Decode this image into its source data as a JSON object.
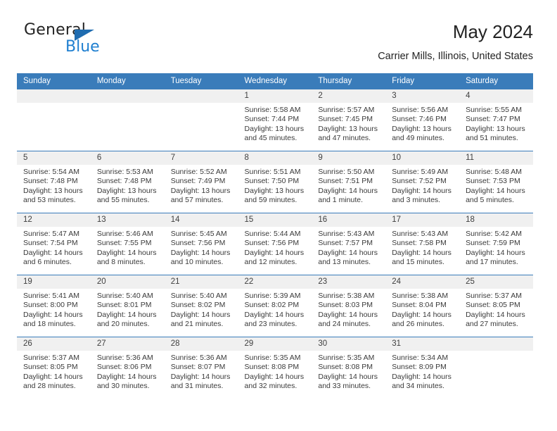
{
  "brand": {
    "name_top": "General",
    "name_bottom": "Blue",
    "accent_color": "#1f7fd0",
    "triangle_color": "#1f6cb0"
  },
  "header": {
    "title": "May 2024",
    "subtitle": "Carrier Mills, Illinois, United States"
  },
  "theme": {
    "header_bg": "#3a7cba",
    "daynum_bg": "#f0f0f0",
    "text": "#3a3a3a"
  },
  "labels": {
    "sunrise_prefix": "Sunrise:",
    "sunset_prefix": "Sunset:",
    "daylight_prefix": "Daylight:"
  },
  "columns": [
    "Sunday",
    "Monday",
    "Tuesday",
    "Wednesday",
    "Thursday",
    "Friday",
    "Saturday"
  ],
  "weeks": [
    [
      {
        "day": "",
        "sunrise": "",
        "sunset": "",
        "daylight_line1": "",
        "daylight_line2": ""
      },
      {
        "day": "",
        "sunrise": "",
        "sunset": "",
        "daylight_line1": "",
        "daylight_line2": ""
      },
      {
        "day": "",
        "sunrise": "",
        "sunset": "",
        "daylight_line1": "",
        "daylight_line2": ""
      },
      {
        "day": "1",
        "sunrise": "Sunrise: 5:58 AM",
        "sunset": "Sunset: 7:44 PM",
        "daylight_line1": "Daylight: 13 hours",
        "daylight_line2": "and 45 minutes."
      },
      {
        "day": "2",
        "sunrise": "Sunrise: 5:57 AM",
        "sunset": "Sunset: 7:45 PM",
        "daylight_line1": "Daylight: 13 hours",
        "daylight_line2": "and 47 minutes."
      },
      {
        "day": "3",
        "sunrise": "Sunrise: 5:56 AM",
        "sunset": "Sunset: 7:46 PM",
        "daylight_line1": "Daylight: 13 hours",
        "daylight_line2": "and 49 minutes."
      },
      {
        "day": "4",
        "sunrise": "Sunrise: 5:55 AM",
        "sunset": "Sunset: 7:47 PM",
        "daylight_line1": "Daylight: 13 hours",
        "daylight_line2": "and 51 minutes."
      }
    ],
    [
      {
        "day": "5",
        "sunrise": "Sunrise: 5:54 AM",
        "sunset": "Sunset: 7:48 PM",
        "daylight_line1": "Daylight: 13 hours",
        "daylight_line2": "and 53 minutes."
      },
      {
        "day": "6",
        "sunrise": "Sunrise: 5:53 AM",
        "sunset": "Sunset: 7:48 PM",
        "daylight_line1": "Daylight: 13 hours",
        "daylight_line2": "and 55 minutes."
      },
      {
        "day": "7",
        "sunrise": "Sunrise: 5:52 AM",
        "sunset": "Sunset: 7:49 PM",
        "daylight_line1": "Daylight: 13 hours",
        "daylight_line2": "and 57 minutes."
      },
      {
        "day": "8",
        "sunrise": "Sunrise: 5:51 AM",
        "sunset": "Sunset: 7:50 PM",
        "daylight_line1": "Daylight: 13 hours",
        "daylight_line2": "and 59 minutes."
      },
      {
        "day": "9",
        "sunrise": "Sunrise: 5:50 AM",
        "sunset": "Sunset: 7:51 PM",
        "daylight_line1": "Daylight: 14 hours",
        "daylight_line2": "and 1 minute."
      },
      {
        "day": "10",
        "sunrise": "Sunrise: 5:49 AM",
        "sunset": "Sunset: 7:52 PM",
        "daylight_line1": "Daylight: 14 hours",
        "daylight_line2": "and 3 minutes."
      },
      {
        "day": "11",
        "sunrise": "Sunrise: 5:48 AM",
        "sunset": "Sunset: 7:53 PM",
        "daylight_line1": "Daylight: 14 hours",
        "daylight_line2": "and 5 minutes."
      }
    ],
    [
      {
        "day": "12",
        "sunrise": "Sunrise: 5:47 AM",
        "sunset": "Sunset: 7:54 PM",
        "daylight_line1": "Daylight: 14 hours",
        "daylight_line2": "and 6 minutes."
      },
      {
        "day": "13",
        "sunrise": "Sunrise: 5:46 AM",
        "sunset": "Sunset: 7:55 PM",
        "daylight_line1": "Daylight: 14 hours",
        "daylight_line2": "and 8 minutes."
      },
      {
        "day": "14",
        "sunrise": "Sunrise: 5:45 AM",
        "sunset": "Sunset: 7:56 PM",
        "daylight_line1": "Daylight: 14 hours",
        "daylight_line2": "and 10 minutes."
      },
      {
        "day": "15",
        "sunrise": "Sunrise: 5:44 AM",
        "sunset": "Sunset: 7:56 PM",
        "daylight_line1": "Daylight: 14 hours",
        "daylight_line2": "and 12 minutes."
      },
      {
        "day": "16",
        "sunrise": "Sunrise: 5:43 AM",
        "sunset": "Sunset: 7:57 PM",
        "daylight_line1": "Daylight: 14 hours",
        "daylight_line2": "and 13 minutes."
      },
      {
        "day": "17",
        "sunrise": "Sunrise: 5:43 AM",
        "sunset": "Sunset: 7:58 PM",
        "daylight_line1": "Daylight: 14 hours",
        "daylight_line2": "and 15 minutes."
      },
      {
        "day": "18",
        "sunrise": "Sunrise: 5:42 AM",
        "sunset": "Sunset: 7:59 PM",
        "daylight_line1": "Daylight: 14 hours",
        "daylight_line2": "and 17 minutes."
      }
    ],
    [
      {
        "day": "19",
        "sunrise": "Sunrise: 5:41 AM",
        "sunset": "Sunset: 8:00 PM",
        "daylight_line1": "Daylight: 14 hours",
        "daylight_line2": "and 18 minutes."
      },
      {
        "day": "20",
        "sunrise": "Sunrise: 5:40 AM",
        "sunset": "Sunset: 8:01 PM",
        "daylight_line1": "Daylight: 14 hours",
        "daylight_line2": "and 20 minutes."
      },
      {
        "day": "21",
        "sunrise": "Sunrise: 5:40 AM",
        "sunset": "Sunset: 8:02 PM",
        "daylight_line1": "Daylight: 14 hours",
        "daylight_line2": "and 21 minutes."
      },
      {
        "day": "22",
        "sunrise": "Sunrise: 5:39 AM",
        "sunset": "Sunset: 8:02 PM",
        "daylight_line1": "Daylight: 14 hours",
        "daylight_line2": "and 23 minutes."
      },
      {
        "day": "23",
        "sunrise": "Sunrise: 5:38 AM",
        "sunset": "Sunset: 8:03 PM",
        "daylight_line1": "Daylight: 14 hours",
        "daylight_line2": "and 24 minutes."
      },
      {
        "day": "24",
        "sunrise": "Sunrise: 5:38 AM",
        "sunset": "Sunset: 8:04 PM",
        "daylight_line1": "Daylight: 14 hours",
        "daylight_line2": "and 26 minutes."
      },
      {
        "day": "25",
        "sunrise": "Sunrise: 5:37 AM",
        "sunset": "Sunset: 8:05 PM",
        "daylight_line1": "Daylight: 14 hours",
        "daylight_line2": "and 27 minutes."
      }
    ],
    [
      {
        "day": "26",
        "sunrise": "Sunrise: 5:37 AM",
        "sunset": "Sunset: 8:05 PM",
        "daylight_line1": "Daylight: 14 hours",
        "daylight_line2": "and 28 minutes."
      },
      {
        "day": "27",
        "sunrise": "Sunrise: 5:36 AM",
        "sunset": "Sunset: 8:06 PM",
        "daylight_line1": "Daylight: 14 hours",
        "daylight_line2": "and 30 minutes."
      },
      {
        "day": "28",
        "sunrise": "Sunrise: 5:36 AM",
        "sunset": "Sunset: 8:07 PM",
        "daylight_line1": "Daylight: 14 hours",
        "daylight_line2": "and 31 minutes."
      },
      {
        "day": "29",
        "sunrise": "Sunrise: 5:35 AM",
        "sunset": "Sunset: 8:08 PM",
        "daylight_line1": "Daylight: 14 hours",
        "daylight_line2": "and 32 minutes."
      },
      {
        "day": "30",
        "sunrise": "Sunrise: 5:35 AM",
        "sunset": "Sunset: 8:08 PM",
        "daylight_line1": "Daylight: 14 hours",
        "daylight_line2": "and 33 minutes."
      },
      {
        "day": "31",
        "sunrise": "Sunrise: 5:34 AM",
        "sunset": "Sunset: 8:09 PM",
        "daylight_line1": "Daylight: 14 hours",
        "daylight_line2": "and 34 minutes."
      },
      {
        "day": "",
        "sunrise": "",
        "sunset": "",
        "daylight_line1": "",
        "daylight_line2": ""
      }
    ]
  ]
}
